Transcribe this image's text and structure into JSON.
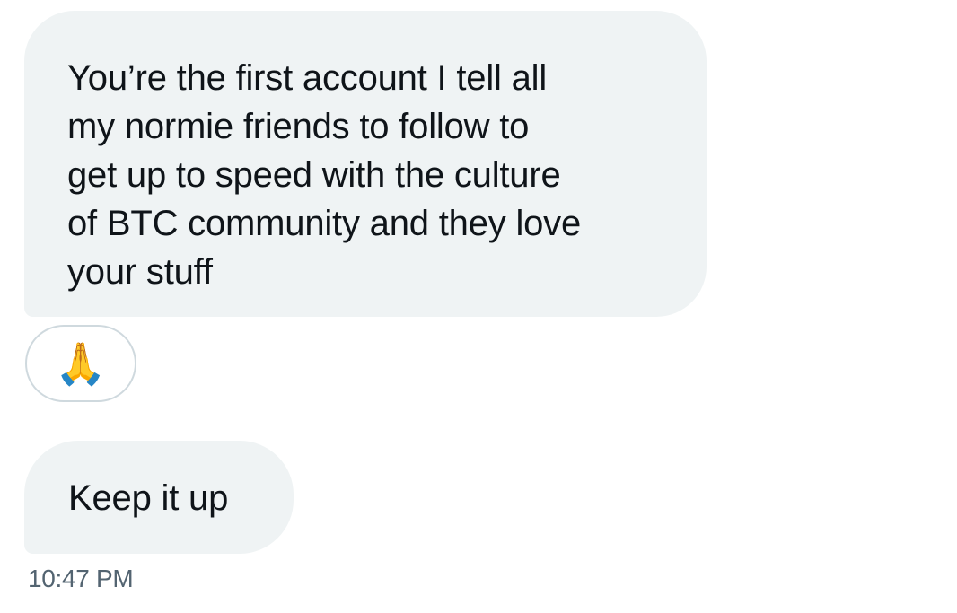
{
  "messages": [
    {
      "text": "You’re the first account I tell all\nmy normie friends to follow to\nget up to speed with the culture\nof BTC community and they love\nyour stuff",
      "reaction": "🙏",
      "reaction_icon": "folded-hands-icon"
    },
    {
      "text": "Keep it up"
    }
  ],
  "timestamp": "10:47 PM",
  "colors": {
    "bubble_background": "#eff3f4",
    "text": "#0f1419",
    "timestamp": "#536471",
    "reaction_border": "#cfd9de"
  }
}
